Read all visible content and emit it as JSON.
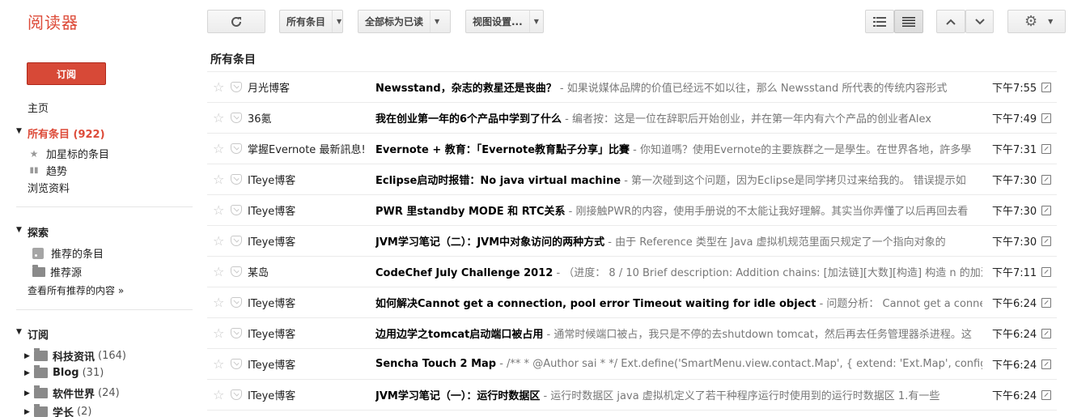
{
  "app": {
    "logo": "阅读器",
    "accent": "#dd4b39"
  },
  "toolbar": {
    "refresh_icon": "refresh-icon",
    "filter_label": "所有条目",
    "mark_all_read": "全部标为已读",
    "view_settings": "视图设置...",
    "list_view_icon": "list-view-icon",
    "expanded_view_icon": "expanded-view-icon",
    "prev_icon": "chevron-up-icon",
    "next_icon": "chevron-down-icon",
    "settings_icon": "gear-icon"
  },
  "sidebar": {
    "subscribe": "订阅",
    "home": "主页",
    "all_items": "所有条目 (922)",
    "starred": "加星标的条目",
    "trends": "趋势",
    "browse": "浏览资料",
    "explore": {
      "title": "探索",
      "recommended_items": "推荐的条目",
      "recommended_sources": "推荐源",
      "view_all": "查看所有推荐的内容 »"
    },
    "subscriptions": {
      "title": "订阅",
      "folders": [
        {
          "name": "科技资讯",
          "count": "(164)"
        },
        {
          "name": "Blog",
          "count": "(31)"
        },
        {
          "name": "软件世界",
          "count": "(24)"
        },
        {
          "name": "学长",
          "count": "(2)"
        }
      ]
    }
  },
  "main": {
    "title": "所有条目",
    "items": [
      {
        "source": "月光博客",
        "title": "Newsstand，杂志的救星还是丧曲？",
        "snippet": " -       如果说媒体品牌的价值已经远不如以往，那么 Newsstand 所代表的传统内容形式",
        "time": "下午7:55"
      },
      {
        "source": "36氪",
        "title": "我在创业第一年的6个产品中学到了什么",
        "snippet": " - 编者按：这是一位在辞职后开始创业，并在第一年内有六个产品的创业者Alex",
        "time": "下午7:49"
      },
      {
        "source": "掌握Evernote 最新訊息!",
        "title": "Evernote + 教育：「Evernote教育點子分享」比賽",
        "snippet": " - 你知道嗎？使用Evernote的主要族群之一是學生。在世界各地，許多學",
        "time": "下午7:31"
      },
      {
        "source": "ITeye博客",
        "title": "Eclipse启动时报错：No java virtual machine",
        "snippet": " - 第一次碰到这个问题，因为Eclipse是同学拷贝过来给我的。 错误提示如",
        "time": "下午7:30"
      },
      {
        "source": "ITeye博客",
        "title": "PWR 里standby MODE 和 RTC关系",
        "snippet": " - 刚接触PWR的内容，使用手册说的不太能让我好理解。其实当你弄懂了以后再回去看",
        "time": "下午7:30"
      },
      {
        "source": "ITeye博客",
        "title": "JVM学习笔记（二）：JVM中对象访问的两种方式",
        "snippet": " - 由于 Reference 类型在 Java 虚拟机规范里面只规定了一个指向对象的",
        "time": "下午7:30"
      },
      {
        "source": "某岛",
        "title": "CodeChef July Challenge 2012",
        "snippet": " - （进度： 8 / 10 Brief description: Addition chains: [加法链][大数][构造] 构造 n 的加法链、",
        "time": "下午7:11"
      },
      {
        "source": "ITeye博客",
        "title": "如何解决Cannot get a connection, pool error Timeout waiting for idle object",
        "snippet": " - 问题分析：  Cannot get a connection,",
        "time": "下午6:24"
      },
      {
        "source": "ITeye博客",
        "title": "边用边学之tomcat启动端口被占用",
        "snippet": " - 通常时候端口被占，我只是不停的去shutdown tomcat，然后再去任务管理器杀进程。这",
        "time": "下午6:24"
      },
      {
        "source": "ITeye博客",
        "title": "Sencha Touch 2 Map",
        "snippet": " - /** * @Author sai * */ Ext.define('SmartMenu.view.contact.Map', { extend: 'Ext.Map', config: {",
        "time": "下午6:24"
      },
      {
        "source": "ITeye博客",
        "title": "JVM学习笔记（一）：运行时数据区",
        "snippet": " - 运行时数据区    java 虚拟机定义了若干种程序运行时使用到的运行时数据区 1.有一些",
        "time": "下午6:24"
      }
    ]
  }
}
